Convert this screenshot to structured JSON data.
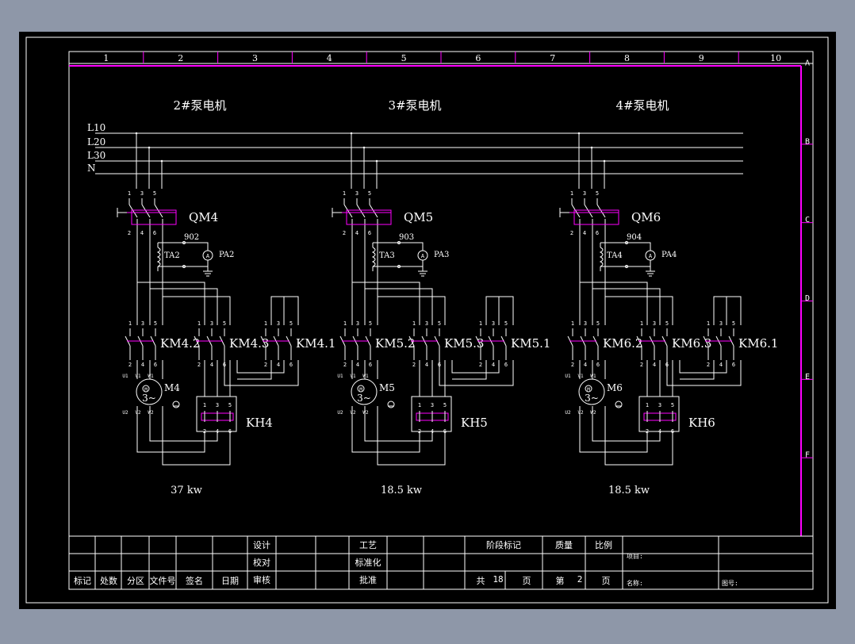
{
  "colors": {
    "background": "#8e97a8",
    "paper": "#000000",
    "line": "#ffffff",
    "magenta": "#ff00ff"
  },
  "zones": {
    "columns": [
      "1",
      "2",
      "3",
      "4",
      "5",
      "6",
      "7",
      "8",
      "9",
      "10"
    ],
    "rows": [
      "A",
      "B",
      "C",
      "D",
      "E",
      "F"
    ]
  },
  "buses": [
    "L10",
    "L20",
    "L30",
    "N"
  ],
  "pumps": [
    {
      "title": "2#泵电机",
      "breaker": "QM4",
      "ct": "TA2",
      "wire": "902",
      "ammeter": "PA2",
      "contactors": [
        "KM4.2",
        "KM4.3",
        "KM4.1"
      ],
      "motor": "M4",
      "relay": "KH4",
      "power": "37 kw"
    },
    {
      "title": "3#泵电机",
      "breaker": "QM5",
      "ct": "TA3",
      "wire": "903",
      "ammeter": "PA3",
      "contactors": [
        "KM5.2",
        "KM5.3",
        "KM5.1"
      ],
      "motor": "M5",
      "relay": "KH5",
      "power": "18.5 kw"
    },
    {
      "title": "4#泵电机",
      "breaker": "QM6",
      "ct": "TA4",
      "wire": "904",
      "ammeter": "PA4",
      "contactors": [
        "KM6.2",
        "KM6.3",
        "KM6.1"
      ],
      "motor": "M6",
      "relay": "KH6",
      "power": "18.5 kw"
    }
  ],
  "labels": {
    "pole_top": [
      "1",
      "3",
      "5"
    ],
    "pole_bottom": [
      "2",
      "4",
      "6"
    ],
    "motor_terms_top": [
      "U1",
      "V1",
      "W1"
    ],
    "motor_terms_bottom": [
      "U2",
      "V2",
      "W2"
    ],
    "motor_circle": "M",
    "motor_phase": "3~"
  },
  "title_block": {
    "header": [
      "标记",
      "处数",
      "分区",
      "文件号",
      "签名",
      "日期"
    ],
    "roles": [
      "设计",
      "校对",
      "审核"
    ],
    "process": [
      "工艺",
      "标准化",
      "批准"
    ],
    "stage_mark": "阶段标记",
    "weight": "质量",
    "scale": "比例",
    "total_prefix": "共",
    "total_value": "18",
    "page_unit": "页",
    "page_prefix": "第",
    "page_value": "2",
    "project": "项目:",
    "name": "名称:",
    "drawing_no": "图号:"
  }
}
